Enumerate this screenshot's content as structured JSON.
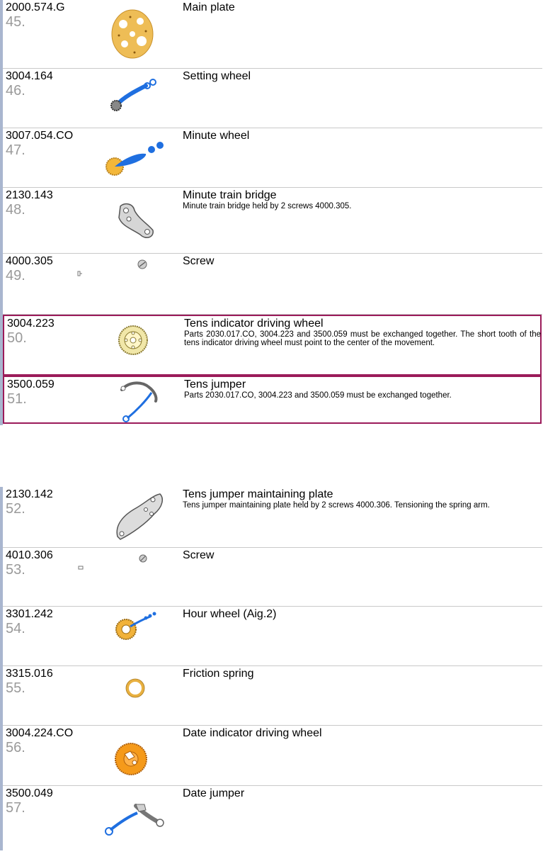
{
  "parts": [
    {
      "ref": "2000.574.G",
      "num": "45.",
      "title": "Main plate",
      "desc": "",
      "icon": "main-plate-icon"
    },
    {
      "ref": "3004.164",
      "num": "46.",
      "title": "Setting wheel",
      "desc": "",
      "icon": "setting-wheel-icon"
    },
    {
      "ref": "3007.054.CO",
      "num": "47.",
      "title": "Minute wheel",
      "desc": "",
      "icon": "minute-wheel-icon"
    },
    {
      "ref": "2130.143",
      "num": "48.",
      "title": "Minute train bridge",
      "desc": "Minute train bridge held by 2 screws 4000.305.",
      "icon": "bridge-icon"
    },
    {
      "ref": "4000.305",
      "num": "49.",
      "title": "Screw",
      "desc": "",
      "icon": "screw-icon"
    },
    {
      "ref": "3004.223",
      "num": "50.",
      "title": "Tens indicator driving wheel",
      "desc": "Parts 2030.017.CO, 3004.223 and 3500.059 must be exchanged together. The short tooth of the tens indicator driving wheel must point to the center of the movement.",
      "icon": "tens-driving-wheel-icon"
    },
    {
      "ref": "3500.059",
      "num": "51.",
      "title": "Tens jumper",
      "desc": "Parts 2030.017.CO, 3004.223 and 3500.059 must be exchanged together.",
      "icon": "tens-jumper-icon"
    },
    {
      "ref": "2130.142",
      "num": "52.",
      "title": "Tens jumper maintaining plate",
      "desc": "Tens jumper maintaining plate held by 2 screws 4000.306. Tensioning the spring arm.",
      "icon": "maintaining-plate-icon"
    },
    {
      "ref": "4010.306",
      "num": "53.",
      "title": "Screw",
      "desc": "",
      "icon": "screw-icon"
    },
    {
      "ref": "3301.242",
      "num": "54.",
      "title": "Hour wheel (Aig.2)",
      "desc": "",
      "icon": "hour-wheel-icon"
    },
    {
      "ref": "3315.016",
      "num": "55.",
      "title": "Friction spring",
      "desc": "",
      "icon": "friction-spring-icon"
    },
    {
      "ref": "3004.224.CO",
      "num": "56.",
      "title": "Date indicator driving wheel",
      "desc": "",
      "icon": "date-driving-wheel-icon"
    },
    {
      "ref": "3500.049",
      "num": "57.",
      "title": "Date jumper",
      "desc": "",
      "icon": "date-jumper-icon"
    }
  ],
  "colors": {
    "highlight": "#9b1b5a",
    "blue": "#1f6fe0",
    "gold": "#e8b040",
    "orange": "#f39a18",
    "steel": "#c9c9c9"
  }
}
